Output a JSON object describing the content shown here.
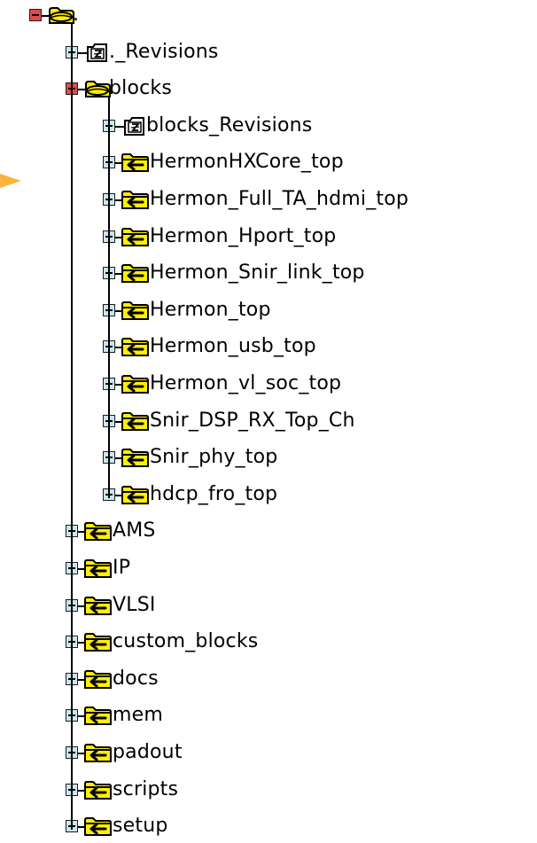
{
  "colors": {
    "folder_fill": "#ffef00",
    "folder_outline": "#000000",
    "expand_box": "#c9e7ee",
    "collapse_box": "#e14b4b",
    "pointer_arrow": "#f7b53b"
  },
  "tree": {
    "root": {
      "label": ".",
      "expanded": true,
      "icon": "open-folder-icon"
    },
    "children": [
      {
        "label": "._Revisions",
        "icon": "revision-folder-icon",
        "expanded": false
      },
      {
        "label": "blocks",
        "icon": "open-folder-icon",
        "expanded": true,
        "children": [
          {
            "label": "blocks_Revisions",
            "icon": "revision-folder-icon",
            "expanded": false
          },
          {
            "label": "HermonHXCore_top",
            "icon": "linked-folder-icon",
            "expanded": false
          },
          {
            "label": "Hermon_Full_TA_hdmi_top",
            "icon": "linked-folder-icon",
            "expanded": false
          },
          {
            "label": "Hermon_Hport_top",
            "icon": "linked-folder-icon",
            "expanded": false
          },
          {
            "label": "Hermon_Snir_link_top",
            "icon": "linked-folder-icon",
            "expanded": false
          },
          {
            "label": "Hermon_top",
            "icon": "linked-folder-icon",
            "expanded": false
          },
          {
            "label": "Hermon_usb_top",
            "icon": "linked-folder-icon",
            "expanded": false
          },
          {
            "label": "Hermon_vl_soc_top",
            "icon": "linked-folder-icon",
            "expanded": false
          },
          {
            "label": "Snir_DSP_RX_Top_Ch",
            "icon": "linked-folder-icon",
            "expanded": false
          },
          {
            "label": "Snir_phy_top",
            "icon": "linked-folder-icon",
            "expanded": false
          },
          {
            "label": "hdcp_fro_top",
            "icon": "linked-folder-icon",
            "expanded": false
          }
        ]
      },
      {
        "label": "AMS",
        "icon": "linked-folder-icon",
        "expanded": false
      },
      {
        "label": "IP",
        "icon": "linked-folder-icon",
        "expanded": false
      },
      {
        "label": "VLSI",
        "icon": "linked-folder-icon",
        "expanded": false
      },
      {
        "label": "custom_blocks",
        "icon": "linked-folder-icon",
        "expanded": false
      },
      {
        "label": "docs",
        "icon": "linked-folder-icon",
        "expanded": false
      },
      {
        "label": "mem",
        "icon": "linked-folder-icon",
        "expanded": false
      },
      {
        "label": "padout",
        "icon": "linked-folder-icon",
        "expanded": false
      },
      {
        "label": "scripts",
        "icon": "linked-folder-icon",
        "expanded": false
      },
      {
        "label": "setup",
        "icon": "linked-folder-icon",
        "expanded": false
      }
    ]
  }
}
